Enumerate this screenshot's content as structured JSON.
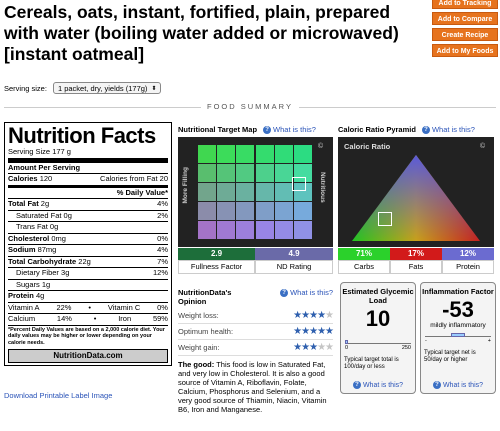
{
  "title": "Cereals, oats, instant, fortified, plain, prepared with water (boiling water added or microwaved) [instant oatmeal]",
  "actions": [
    "Add to Tracking",
    "Add to Compare",
    "Create Recipe",
    "Add to My Foods"
  ],
  "serving": {
    "label": "Serving size:",
    "value": "1 packet, dry, yields (177g)"
  },
  "section_title": "FOOD SUMMARY",
  "label": {
    "heading": "Nutrition Facts",
    "serving_size": "Serving Size",
    "serving_size_value": "177 g",
    "amount_per": "Amount Per Serving",
    "calories": "Calories",
    "calories_value": "120",
    "calories_fat": "Calories from Fat 20",
    "dv_header": "% Daily Value*",
    "rows": [
      {
        "name": "Total Fat",
        "amount": "2g",
        "dv": "4%"
      },
      {
        "name": "Saturated Fat",
        "amount": "0g",
        "dv": "2%"
      },
      {
        "name": "Trans Fat",
        "amount": "0g",
        "dv": ""
      },
      {
        "name": "Cholesterol",
        "amount": "0mg",
        "dv": "0%"
      },
      {
        "name": "Sodium",
        "amount": "87mg",
        "dv": "4%"
      },
      {
        "name": "Total Carbohydrate",
        "amount": "22g",
        "dv": "7%"
      },
      {
        "name": "Dietary Fiber",
        "amount": "3g",
        "dv": "12%"
      },
      {
        "name": "Sugars",
        "amount": "1g",
        "dv": ""
      },
      {
        "name": "Protein",
        "amount": "4g",
        "dv": ""
      }
    ],
    "vitamins": [
      {
        "a": "Vitamin A",
        "a_pct": "22%",
        "b": "Vitamin C",
        "b_pct": "0%"
      },
      {
        "a": "Calcium",
        "a_pct": "14%",
        "b": "Iron",
        "b_pct": "59%"
      }
    ],
    "footnote": "*Percent Daily Values are based on a 2,000 calorie diet. Your daily values may be higher or lower depending on your calorie needs.",
    "brand": "NutritionData.com"
  },
  "download_link": "Download Printable Label Image",
  "what_is_this": "What is this?",
  "target_map": {
    "title": "Nutritional Target Map",
    "left_label": "More Filling",
    "right_label": "Nutritious",
    "copyright": "©",
    "fullness_value": "2.9",
    "fullness_label": "Fullness Factor",
    "nd_value": "4.9",
    "nd_label": "ND Rating"
  },
  "pyramid": {
    "title": "Caloric Ratio Pyramid",
    "inner_title": "Caloric Ratio",
    "copyright": "©",
    "carbs_value": "71%",
    "carbs_label": "Carbs",
    "fats_value": "17%",
    "fats_label": "Fats",
    "protein_value": "12%",
    "protein_label": "Protein",
    "colors": {
      "carbs": "#2bd12b",
      "fats": "#d21a1a",
      "protein": "#6b6bd0"
    }
  },
  "opinion": {
    "title": "NutritionData's Opinion",
    "rows": [
      {
        "label": "Weight loss:",
        "stars": 4
      },
      {
        "label": "Optimum health:",
        "stars": 5
      },
      {
        "label": "Weight gain:",
        "stars": 3
      }
    ],
    "good_lead": "The good:",
    "good_text": " This food is low in Saturated Fat, and very low in Cholesterol. It is also a good source of Vitamin A, Riboflavin, Folate, Calcium, Phosphorus and Selenium, and a very good source of Thiamin, Niacin, Vitamin B6, Iron and Manganese."
  },
  "glycemic": {
    "title": "Estimated Glycemic Load",
    "value": "10",
    "scale_min": "0",
    "scale_max": "250",
    "note": "Typical target total is 100/day or less"
  },
  "inflammation": {
    "title": "Inflammation Factor",
    "value": "-53",
    "sub": "mildly inflammatory",
    "scale_min": "-",
    "scale_max": "+",
    "note": "Typical target net is 50/day or higher"
  }
}
